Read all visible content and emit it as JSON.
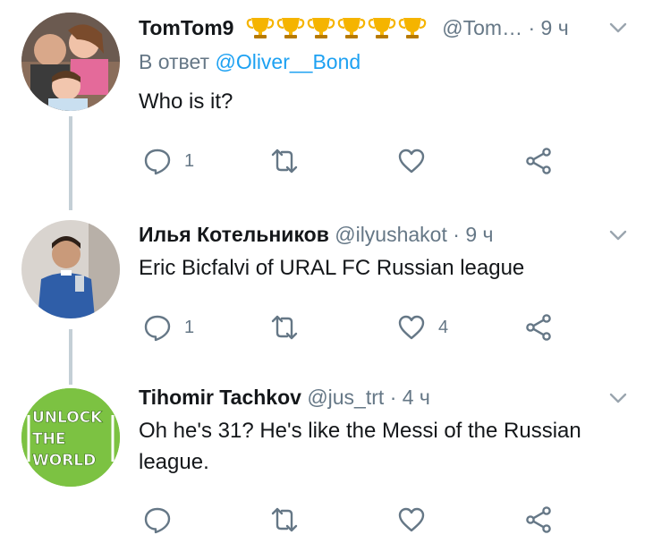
{
  "tweets": [
    {
      "name": "TomTom9",
      "trophy_count": 6,
      "handle": "@Tom…",
      "dot": "·",
      "time": "9 ч",
      "reply_prefix": "В ответ",
      "reply_to": "@Oliver__Bond",
      "text": "Who is it?",
      "replies": "1",
      "retweets": "",
      "likes": ""
    },
    {
      "name": "Илья Котельников",
      "handle": "@ilyushakot",
      "dot": "·",
      "time": "9 ч",
      "text": "Eric Bicfalvi of URAL FC Russian league",
      "replies": "1",
      "retweets": "",
      "likes": "4"
    },
    {
      "name": "Tihomir Tachkov",
      "handle": "@jus_trt",
      "dot": "·",
      "time": "4 ч",
      "text": "Oh he's 31? He's like the Messi of the Russian league.",
      "replies": "",
      "retweets": "",
      "likes": ""
    }
  ],
  "avatar3": {
    "lines": [
      "UNLOCK",
      "THE",
      "WORLD"
    ]
  },
  "colors": {
    "gray": "#657786",
    "link": "#1da1f2",
    "thread": "#c4cfd6",
    "green": "#7cc242",
    "trophy": "#f5b400"
  }
}
